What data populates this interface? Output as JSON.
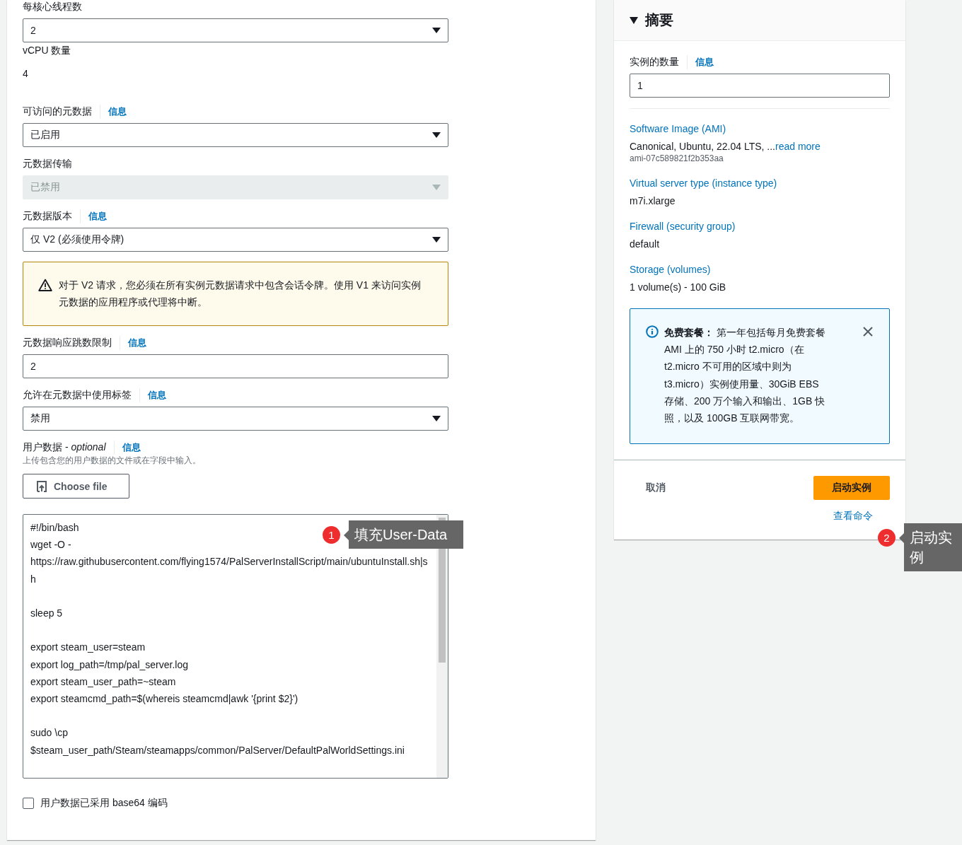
{
  "form": {
    "fields": [
      {
        "kind": "select",
        "label": "每核心线程数",
        "value": "2",
        "disabled": false
      },
      {
        "kind": "static",
        "label": "vCPU 数量",
        "value": "4"
      },
      {
        "kind": "select",
        "label": "可访问的元数据",
        "info": "信息",
        "value": "已启用",
        "disabled": false
      },
      {
        "kind": "select",
        "label": "元数据传输",
        "value": "已禁用",
        "disabled": true
      },
      {
        "kind": "select",
        "label": "元数据版本",
        "info": "信息",
        "value": "仅 V2 (必须使用令牌)",
        "disabled": false
      },
      {
        "kind": "alert",
        "text": "对于 V2 请求，您必须在所有实例元数据请求中包含会话令牌。使用 V1 来访问实例元数据的应用程序或代理将中断。"
      },
      {
        "kind": "input",
        "label": "元数据响应跳数限制",
        "info": "信息",
        "value": "2"
      },
      {
        "kind": "select",
        "label": "允许在元数据中使用标签",
        "info": "信息",
        "value": "禁用",
        "disabled": false
      },
      {
        "kind": "userdata",
        "label": "用户数据 - *optional*",
        "info": "信息",
        "description": "上传包含您的用户数据的文件或在字段中输入。",
        "button": "Choose file",
        "blocks": [
          [
            "#!/bin/bash",
            "wget -O - https://raw.githubusercontent.com/flying1574/PalServerInstallScript/main/ubuntuInstall.sh|sh"
          ],
          [
            "sleep 5"
          ],
          [
            "export steam_user=steam",
            "export log_path=/tmp/pal_server.log",
            "export steam_user_path=~steam",
            "export steamcmd_path=$(whereis steamcmd|awk '{print $2}')"
          ],
          [
            "sudo \\cp $steam_user_path/Steam/steamapps/common/PalServer/DefaultPalWorldSettings.ini"
          ]
        ]
      },
      {
        "kind": "checkbox",
        "label": "用户数据已采用 base64 编码",
        "checked": false
      }
    ]
  },
  "summary": {
    "title": "摘要",
    "expanded": true,
    "count_label": "实例的数量",
    "count_info": "信息",
    "count_value": "1",
    "sections": [
      {
        "heading": "Software Image (AMI)",
        "value": "Canonical, Ubuntu, 22.04 LTS, ...",
        "link": "read more",
        "sub": "ami-07c589821f2b353aa"
      },
      {
        "heading": "Virtual server type (instance type)",
        "value": "m7i.xlarge"
      },
      {
        "heading": "Firewall (security group)",
        "value": "default"
      },
      {
        "heading": "Storage (volumes)",
        "value": "1 volume(s) - 100 GiB"
      }
    ],
    "notice": "**免费套餐：** 第一年包括每月免费套餐 AMI 上的 750 小时 t2.micro（在 t2.micro 不可用的区域中则为 t3.micro）实例使用量、30GiB EBS 存储、200 万个输入和输出、1GB 快照，以及 100GB 互联网带宽。",
    "cancel": "取消",
    "launch": "启动实例",
    "view_command": "查看命令"
  },
  "annotations": [
    {
      "number": "1",
      "text": "填充User-Data"
    },
    {
      "number": "2",
      "text": "启动实例"
    }
  ]
}
